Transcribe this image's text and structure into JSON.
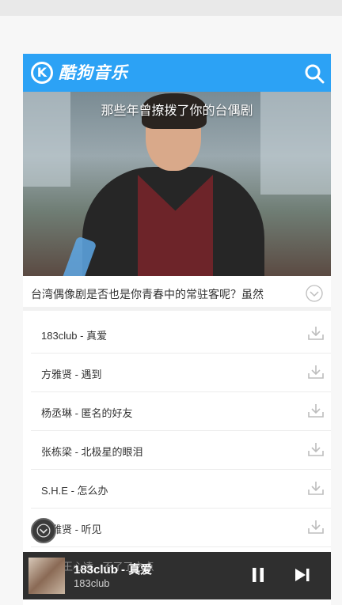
{
  "app": {
    "brand": "酷狗音乐",
    "logo_letter": "K"
  },
  "banner": {
    "title": "那些年曾撩拨了你的台偶剧"
  },
  "intro": {
    "text": "台湾偶像剧是否也是你青春中的常驻客呢？虽然"
  },
  "songs": [
    {
      "label": "183club - 真爱"
    },
    {
      "label": "方雅贤 - 遇到"
    },
    {
      "label": "杨丞琳 - 匿名的好友"
    },
    {
      "label": "张栋梁 - 北极星的眼泪"
    },
    {
      "label": "S.H.E - 怎么办"
    },
    {
      "label": "方雅贤 - 听见"
    },
    {
      "label": "王心凌 - 不了了之点"
    }
  ],
  "player": {
    "title": "183club - 真爱",
    "artist": "183club"
  },
  "colors": {
    "header": "#2ca2f5",
    "player": "#2f2f2f"
  },
  "icons": [
    "kugou-logo-icon",
    "search-icon",
    "chevron-down-icon",
    "download-icon",
    "pause-icon",
    "next-icon"
  ]
}
